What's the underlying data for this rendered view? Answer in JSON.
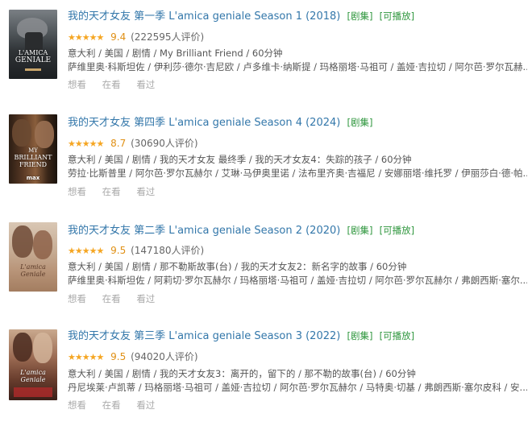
{
  "results": [
    {
      "title": "我的天才女友 第一季 L'amica geniale Season 1 (2018)",
      "tags": [
        "[剧集]",
        "[可播放]"
      ],
      "stars": "★★★★★",
      "score": "9.4",
      "votes": "(222595人评价)",
      "meta1": "意大利 / 美国 / 剧情 / My Brilliant Friend / 60分钟",
      "meta2": "萨维里奥·科斯坦佐 / 伊利莎·德尔·吉尼欧 / 卢多维卡·纳斯提 / 玛格丽塔·马祖可 / 盖娅·吉拉切 / 阿尔芭·罗尔瓦赫...",
      "actions": [
        "想看",
        "在看",
        "看过"
      ],
      "poster_text": [
        "L'AMICA",
        "GENIALE"
      ]
    },
    {
      "title": "我的天才女友 第四季 L'amica geniale Season 4 (2024)",
      "tags": [
        "[剧集]"
      ],
      "stars": "★★★★★",
      "score": "8.7",
      "votes": "(30690人评价)",
      "meta1": "意大利 / 美国 / 剧情 / 我的天才女友 最终季 / 我的天才女友4：失踪的孩子 / 60分钟",
      "meta2": "劳拉·比斯普里 / 阿尔芭·罗尔瓦赫尔 / 艾琳·马伊奥里诺 / 法布里齐奥·吉福尼 / 安娜丽塔·维托罗 / 伊丽莎白·德·帕...",
      "actions": [
        "想看",
        "在看",
        "看过"
      ],
      "poster_text": [
        "MY",
        "BRILLIANT",
        "FRIEND",
        "max"
      ]
    },
    {
      "title": "我的天才女友 第二季 L'amica geniale Season 2 (2020)",
      "tags": [
        "[剧集]",
        "[可播放]"
      ],
      "stars": "★★★★★",
      "score": "9.5",
      "votes": "(147180人评价)",
      "meta1": "意大利 / 美国 / 剧情 / 那不勒斯故事(台) / 我的天才女友2：新名字的故事 / 60分钟",
      "meta2": "萨维里奥·科斯坦佐 / 阿莉切·罗尔瓦赫尔 / 玛格丽塔·马祖可 / 盖娅·吉拉切 / 阿尔芭·罗尔瓦赫尔 / 弗朗西斯·塞尔...",
      "actions": [
        "想看",
        "在看",
        "看过"
      ],
      "poster_text": [
        "L'amica",
        "Geniale"
      ]
    },
    {
      "title": "我的天才女友 第三季 L'amica geniale Season 3 (2022)",
      "tags": [
        "[剧集]",
        "[可播放]"
      ],
      "stars": "★★★★★",
      "score": "9.5",
      "votes": "(94020人评价)",
      "meta1": "意大利 / 美国 / 剧情 / 我的天才女友3：离开的，留下的 / 那不勒的故事(台) / 60分钟",
      "meta2": "丹尼埃莱·卢凯蒂 / 玛格丽塔·马祖可 / 盖娅·吉拉切 / 阿尔芭·罗尔瓦赫尔 / 马特奥·切基 / 弗朗西斯·塞尔皮科 / 安...",
      "actions": [
        "想看",
        "在看",
        "看过"
      ],
      "poster_text": [
        "L'amica",
        "Geniale"
      ]
    }
  ]
}
